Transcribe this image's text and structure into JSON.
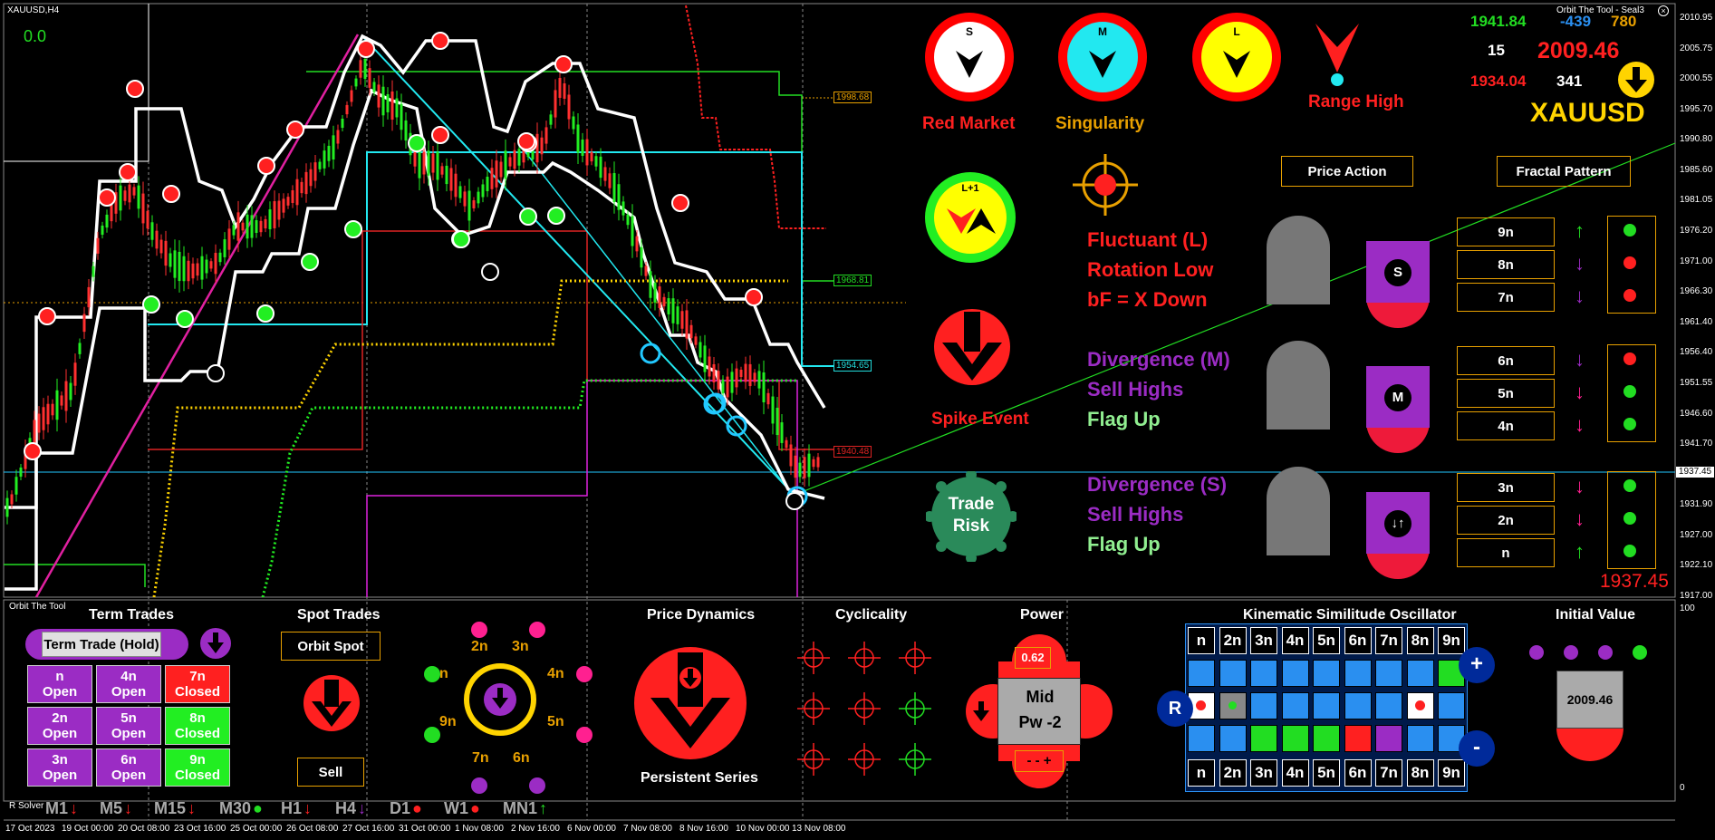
{
  "window": {
    "symbol_tf": "XAUUSD,H4",
    "indicator_name": "Orbit The Tool - Seal3",
    "corner_value": "0.0"
  },
  "price_axis": {
    "ticks": [
      "2010.95",
      "2005.75",
      "2000.55",
      "1995.70",
      "1990.80",
      "1985.60",
      "1981.05",
      "1976.20",
      "1971.00",
      "1966.30",
      "1961.40",
      "1956.40",
      "1951.55",
      "1946.60",
      "1941.70",
      "1937.45",
      "1931.90",
      "1927.00",
      "1922.10",
      "1917.00"
    ],
    "current_price": "1937.45"
  },
  "sub_axis": {
    "top": "100",
    "bottom": "0"
  },
  "chart_levels": [
    {
      "label": "1998.68",
      "color": "#e8a000"
    },
    {
      "label": "1968.81",
      "color": "#22dd22"
    },
    {
      "label": "1954.65",
      "color": "#22dddd"
    },
    {
      "label": "1940.48",
      "color": "#dd2222"
    }
  ],
  "time_axis": {
    "labels": [
      "17 Oct 2023",
      "19 Oct 00:00",
      "20 Oct 08:00",
      "23 Oct 16:00",
      "25 Oct 00:00",
      "26 Oct 08:00",
      "27 Oct 16:00",
      "31 Oct 00:00",
      "1 Nov 08:00",
      "2 Nov 16:00",
      "6 Nov 00:00",
      "7 Nov 08:00",
      "8 Nov 16:00",
      "10 Nov 00:00",
      "13 Nov 08:00"
    ]
  },
  "markets": [
    {
      "letter": "S",
      "label": "Red Market",
      "ring": "#ff0000",
      "fill": "#ffffff"
    },
    {
      "letter": "M",
      "label": "Singularity",
      "ring": "#ff0000",
      "fill": "#22e8f0"
    },
    {
      "letter": "L",
      "label": "",
      "ring": "#ff0000",
      "fill": "#ffff00"
    }
  ],
  "range_high": "Range High",
  "l_plus": "L+1",
  "spike_event": "Spike Event",
  "trade_risk": {
    "line1": "Trade",
    "line2": "Risk"
  },
  "stats": {
    "v1": "1941.84",
    "v2": "-439",
    "v3": "780",
    "v4": "15",
    "v5": "2009.46",
    "v6": "1934.04",
    "v7": "341",
    "symbol": "XAUUSD",
    "bottom_price": "1937.45"
  },
  "buttons": {
    "price_action": "Price Action",
    "fractal_pattern": "Fractal Pattern"
  },
  "cycle_text": [
    {
      "lines": [
        "Fluctuant (L)",
        "Rotation Low",
        "bF = X Down"
      ],
      "colors": [
        "#ff2020",
        "#ff2020",
        "#ff2020"
      ]
    },
    {
      "lines": [
        "Divergence (M)",
        "Sell Highs",
        "Flag Up"
      ],
      "colors": [
        "#9b2cc4",
        "#9b2cc4",
        "#90ee90"
      ]
    },
    {
      "lines": [
        "Divergence (S)",
        "Sell Highs",
        "Flag Up"
      ],
      "colors": [
        "#9b2cc4",
        "#9b2cc4",
        "#90ee90"
      ]
    }
  ],
  "magnet_badges": [
    "S",
    "M",
    "↓↑"
  ],
  "fractal_rows": [
    {
      "label": "9n",
      "arrow": "↑",
      "arrow_color": "#22dd22",
      "dot": "#22dd22"
    },
    {
      "label": "8n",
      "arrow": "↓",
      "arrow_color": "#9b2cc4",
      "dot": "#ff2020"
    },
    {
      "label": "7n",
      "arrow": "↓",
      "arrow_color": "#9b2cc4",
      "dot": "#ff2020"
    },
    {
      "label": "6n",
      "arrow": "↓",
      "arrow_color": "#9b2cc4",
      "dot": "#ff2020"
    },
    {
      "label": "5n",
      "arrow": "↓",
      "arrow_color": "#ff2090",
      "dot": "#22dd22"
    },
    {
      "label": "4n",
      "arrow": "↓",
      "arrow_color": "#ff2090",
      "dot": "#22dd22"
    },
    {
      "label": "3n",
      "arrow": "↓",
      "arrow_color": "#ff2090",
      "dot": "#22dd22"
    },
    {
      "label": "2n",
      "arrow": "↓",
      "arrow_color": "#ff2090",
      "dot": "#22dd22"
    },
    {
      "label": "n",
      "arrow": "↑",
      "arrow_color": "#22dd22",
      "dot": "#22dd22"
    }
  ],
  "bottom": {
    "panel_title": "Orbit The Tool",
    "term_trades": {
      "title": "Term Trades",
      "hold_label": "Term Trade (Hold)",
      "cells": [
        {
          "n": "n",
          "state": "Open",
          "color": "#9b2cc4"
        },
        {
          "n": "4n",
          "state": "Open",
          "color": "#9b2cc4"
        },
        {
          "n": "7n",
          "state": "Closed",
          "color": "#ff2020"
        },
        {
          "n": "2n",
          "state": "Open",
          "color": "#9b2cc4"
        },
        {
          "n": "5n",
          "state": "Open",
          "color": "#9b2cc4"
        },
        {
          "n": "8n",
          "state": "Closed",
          "color": "#22ee22"
        },
        {
          "n": "3n",
          "state": "Open",
          "color": "#9b2cc4"
        },
        {
          "n": "6n",
          "state": "Open",
          "color": "#9b2cc4"
        },
        {
          "n": "9n",
          "state": "Closed",
          "color": "#22ee22"
        }
      ]
    },
    "spot_trades": {
      "title": "Spot Trades",
      "orbit_spot": "Orbit Spot",
      "sell": "Sell"
    },
    "orbit_labels": [
      "2n",
      "3n",
      "4n",
      "5n",
      "6n",
      "7n",
      "9n",
      "n"
    ],
    "price_dynamics": {
      "title": "Price Dynamics",
      "subtitle": "Persistent Series"
    },
    "cyclicality": {
      "title": "Cyclicality"
    },
    "power": {
      "title": "Power",
      "value": "0.62",
      "line1": "Mid",
      "line2": "Pw -2",
      "minus_plus": "- - +"
    },
    "kso": {
      "title": "Kinematic Similitude Oscillator",
      "header": [
        "n",
        "2n",
        "3n",
        "4n",
        "5n",
        "6n",
        "7n",
        "8n",
        "9n"
      ],
      "row1": [
        "#2a8ff0",
        "#2a8ff0",
        "#2a8ff0",
        "#2a8ff0",
        "#2a8ff0",
        "#2a8ff0",
        "#2a8ff0",
        "#2a8ff0",
        "#22dd22"
      ],
      "row2": [
        "#ffffff",
        "#888888",
        "#2a8ff0",
        "#2a8ff0",
        "#2a8ff0",
        "#2a8ff0",
        "#2a8ff0",
        "#ffffff",
        "#2a8ff0"
      ],
      "row3": [
        "#2a8ff0",
        "#2a8ff0",
        "#22dd22",
        "#22dd22",
        "#22dd22",
        "#ff2020",
        "#9b2cc4",
        "#2a8ff0",
        "#2a8ff0"
      ],
      "r_label": "R",
      "plus": "+",
      "minus": "-"
    },
    "initial_value": {
      "title": "Initial Value",
      "value": "2009.46",
      "dots": [
        "#9b2cc4",
        "#9b2cc4",
        "#9b2cc4",
        "#22dd22"
      ]
    },
    "solver_label": "R Solver",
    "timeframes": [
      {
        "tf": "M1",
        "sym": "↓",
        "color": "#ff2020"
      },
      {
        "tf": "M5",
        "sym": "↓",
        "color": "#ff2020"
      },
      {
        "tf": "M15",
        "sym": "↓",
        "color": "#ff2020"
      },
      {
        "tf": "M30",
        "sym": "●",
        "color": "#22dd22"
      },
      {
        "tf": "H1",
        "sym": "↓",
        "color": "#ff2020"
      },
      {
        "tf": "H4",
        "sym": "↓",
        "color": "#9b2cc4"
      },
      {
        "tf": "D1",
        "sym": "●",
        "color": "#ff2020"
      },
      {
        "tf": "W1",
        "sym": "●",
        "color": "#ff2020"
      },
      {
        "tf": "MN1",
        "sym": "↑",
        "color": "#22dd22"
      }
    ]
  }
}
